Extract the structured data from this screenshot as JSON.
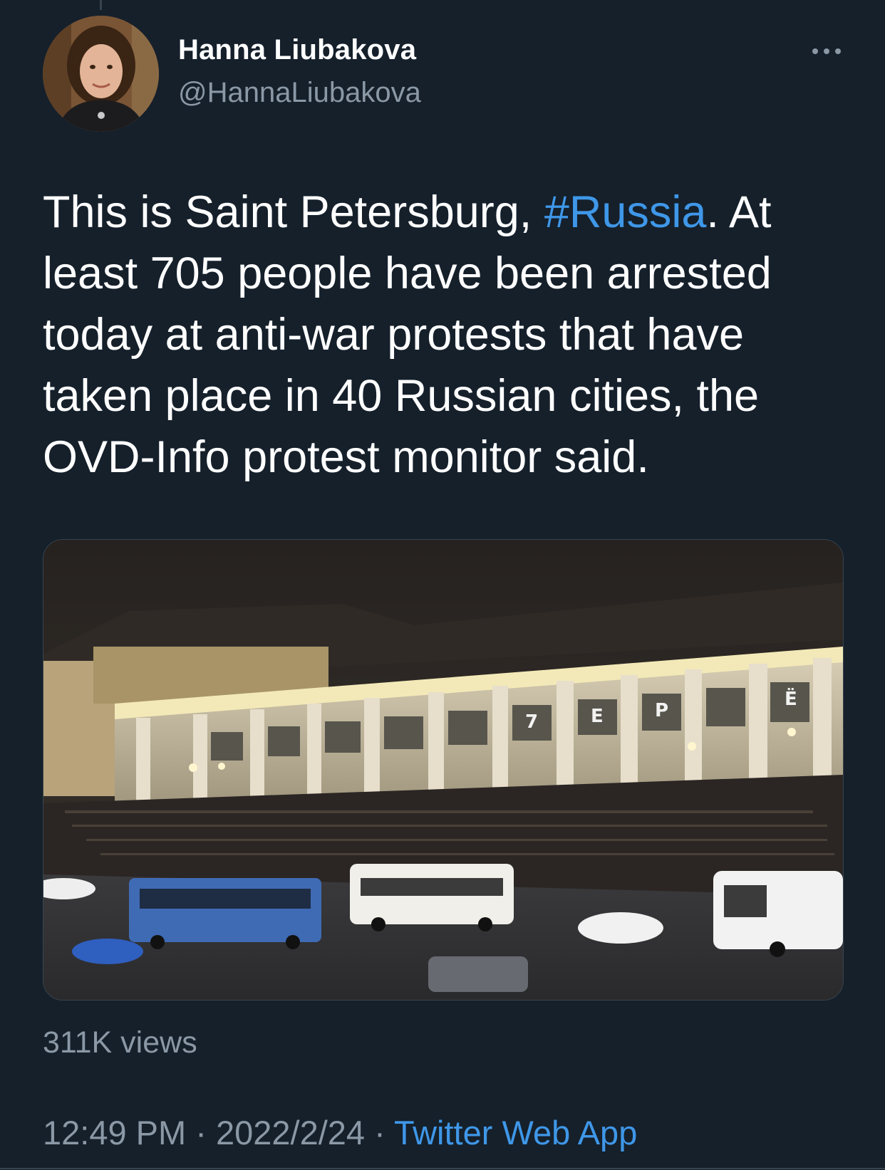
{
  "author": {
    "name": "Hanna Liubakova",
    "handle": "@HannaLiubakova",
    "avatar_icon": "profile-photo"
  },
  "tweet": {
    "text_before": "This is Saint Petersburg, ",
    "hashtag": "#Russia",
    "text_after": ". At least 705 people have been arrested today at anti-war protests that have taken place in 40 Russian cities, the OVD-Info protest monitor said."
  },
  "media": {
    "type": "video-thumbnail",
    "description_icon": "night-street-crowd-photo",
    "facade_letters": [
      "7",
      "E",
      "P",
      "Ё"
    ]
  },
  "views": "311K views",
  "meta": {
    "time": "12:49 PM",
    "separator": " · ",
    "date": "2022/2/24",
    "source": "Twitter Web App"
  },
  "more_icon": "more-horizontal-icon",
  "colors": {
    "background": "#15202b",
    "text": "#ffffff",
    "secondary": "#8b98a5",
    "link": "#3f97e8",
    "border": "#38444d"
  }
}
